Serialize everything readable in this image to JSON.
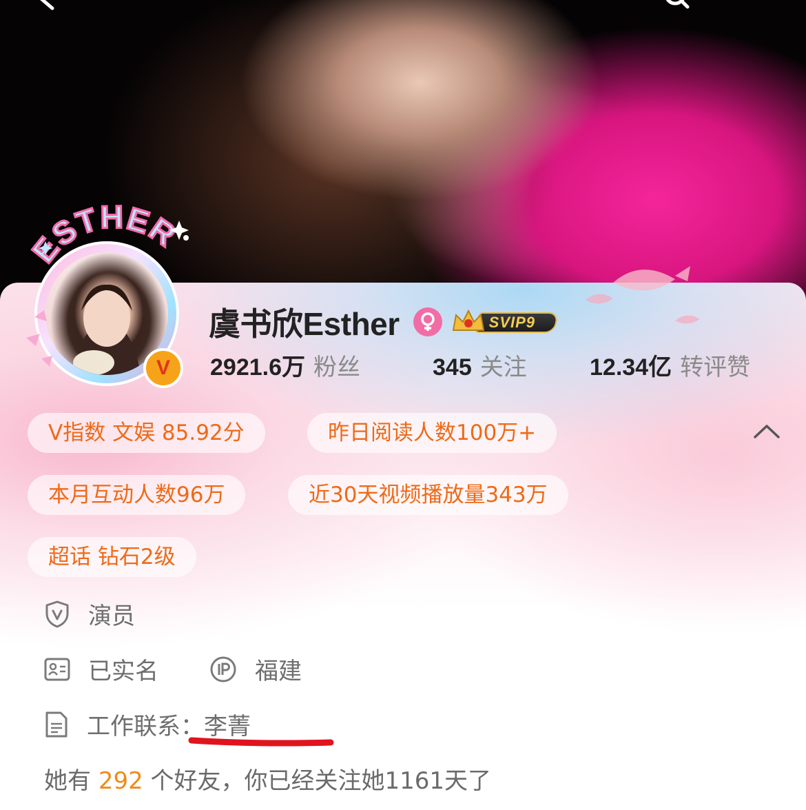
{
  "profile": {
    "name": "虞书欣Esther",
    "svip_label": "SVIP9",
    "avatar_badge_text": "ESTHER",
    "verified_mark": "V"
  },
  "stats": [
    {
      "value": "2921.6万",
      "label": "粉丝"
    },
    {
      "value": "345",
      "label": "关注"
    },
    {
      "value": "12.34亿",
      "label": "转评赞"
    }
  ],
  "tags": {
    "v_index": "V指数 文娱 85.92分",
    "yesterday_reads": "昨日阅读人数100万+",
    "month_interactions": "本月互动人数96万",
    "video_plays": "近30天视频播放量343万",
    "super_topic": "超话 钻石2级"
  },
  "info": {
    "occupation": "演员",
    "real_name_status": "已实名",
    "ip_location": "福建",
    "work_contact": "工作联系：李菁"
  },
  "friends_line": {
    "prefix": "她有 ",
    "count": "292",
    "suffix": " 个好友，你已经关注她1161天了"
  },
  "colors": {
    "accent_orange": "#ee6a18",
    "gender_pink": "#f26da5",
    "underline_red": "#e0141e"
  },
  "icons": [
    "back-icon",
    "search-icon",
    "gender-female-icon",
    "crown-icon",
    "chevron-up-icon",
    "verified-shield-icon",
    "id-card-icon",
    "ip-icon",
    "document-icon"
  ]
}
